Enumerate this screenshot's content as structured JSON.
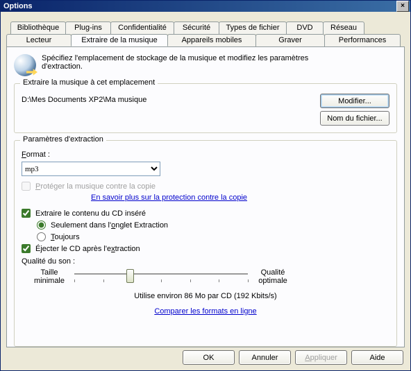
{
  "window": {
    "title": "Options"
  },
  "tabs": {
    "row1": [
      "Bibliothèque",
      "Plug-ins",
      "Confidentialité",
      "Sécurité",
      "Types de fichier",
      "DVD",
      "Réseau"
    ],
    "row2": [
      "Lecteur",
      "Extraire de la musique",
      "Appareils mobiles",
      "Graver",
      "Performances"
    ],
    "active": "Extraire de la musique"
  },
  "header": {
    "text": "Spécifiez l'emplacement de stockage de la musique et modifiez les paramètres d'extraction."
  },
  "location": {
    "group_title": "Extraire la musique à cet emplacement",
    "path": "D:\\Mes Documents XP2\\Ma musique",
    "modify_label": "Modifier...",
    "filename_label": "Nom du fichier..."
  },
  "settings": {
    "group_title": "Paramètres d'extraction",
    "format_label": "Format :",
    "format_value": "mp3",
    "protect_label": "Protéger la musique contre la copie",
    "protect_checked": false,
    "learn_more": "En savoir plus sur la protection contre la copie",
    "autorip_label": "Extraire le contenu du CD inséré",
    "autorip_checked": true,
    "autorip_only_tab": "Seulement dans l'onglet Extraction",
    "autorip_always": "Toujours",
    "autorip_choice": "only_tab",
    "eject_label": "Éjecter le CD après l'extraction",
    "eject_checked": true,
    "quality_label": "Qualité du son :",
    "slider_min": "Taille minimale",
    "slider_max": "Qualité optimale",
    "slider_pos_pct": 32,
    "estimate": "Utilise environ 86 Mo par CD (192 Kbits/s)",
    "compare_link": "Comparer les formats en ligne"
  },
  "footer": {
    "ok": "OK",
    "cancel": "Annuler",
    "apply": "Appliquer",
    "help": "Aide"
  }
}
